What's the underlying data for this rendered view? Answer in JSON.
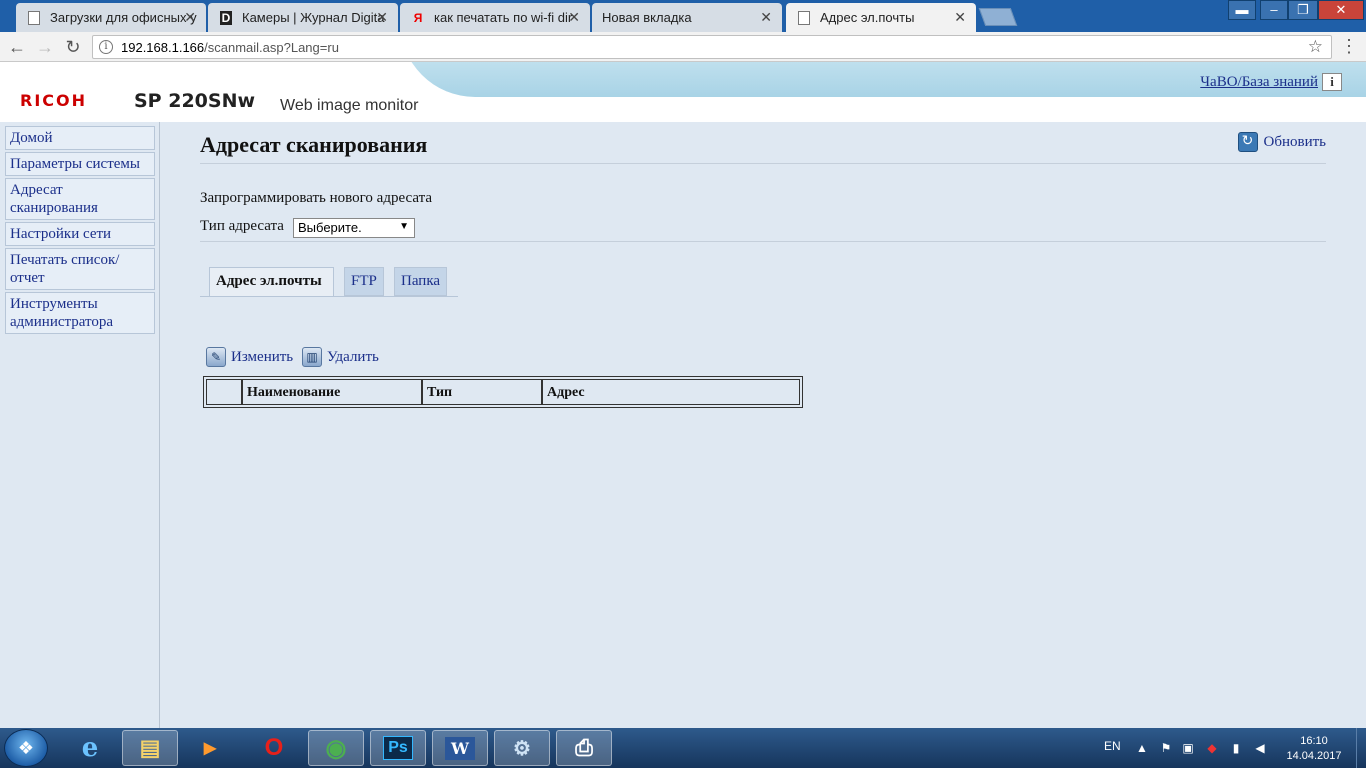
{
  "browser": {
    "tabs": [
      {
        "title": "Загрузки для офисных у",
        "icon": "page-icon"
      },
      {
        "title": "Камеры | Журнал Digita",
        "icon": "digital-d-icon"
      },
      {
        "title": "как печатать по wi-fi dir",
        "icon": "yandex-icon"
      },
      {
        "title": "Новая вкладка",
        "icon": "none"
      },
      {
        "title": "Адрес эл.почты",
        "icon": "page-icon"
      }
    ],
    "close_glyph": "✕",
    "url_host": "192.168.1.166",
    "url_path": "/scanmail.asp?Lang=ru"
  },
  "header": {
    "brand": "RICOH",
    "model": "SP 220SNw",
    "product": "Web image monitor",
    "faq_link": "ЧаВО/База знаний",
    "faq_icon": "i"
  },
  "sidebar": {
    "items": [
      {
        "label": "Домой"
      },
      {
        "label": "Параметры системы"
      },
      {
        "label": "Адресат сканирования"
      },
      {
        "label": "Настройки сети"
      },
      {
        "label": "Печатать список/ отчет"
      },
      {
        "label": "Инструменты администратора"
      }
    ]
  },
  "main": {
    "title": "Адресат сканирования",
    "refresh_label": "Обновить",
    "program_new": "Запрограммировать нового адресата",
    "type_label": "Тип адресата",
    "type_selected": "Выберите.",
    "tabs": [
      {
        "label": "Адрес эл.почты",
        "active": true
      },
      {
        "label": "FTP",
        "active": false
      },
      {
        "label": "Папка",
        "active": false
      }
    ],
    "actions": {
      "edit": "Изменить",
      "delete": "Удалить"
    },
    "table_headers": [
      "",
      "Наименование",
      "Тип",
      "Адрес"
    ]
  },
  "taskbar": {
    "apps": [
      {
        "name": "ie-icon",
        "glyph": "e"
      },
      {
        "name": "explorer-icon",
        "glyph": "▤"
      },
      {
        "name": "media-player-icon",
        "glyph": "▶"
      },
      {
        "name": "opera-icon",
        "glyph": "O"
      },
      {
        "name": "chrome-icon",
        "glyph": "◉"
      },
      {
        "name": "photoshop-icon",
        "glyph": "Ps"
      },
      {
        "name": "word-icon",
        "glyph": "W"
      },
      {
        "name": "control-panel-icon",
        "glyph": "⚙"
      },
      {
        "name": "network-printer-icon",
        "glyph": "⎙"
      }
    ],
    "lang": "EN",
    "time": "16:10",
    "date": "14.04.2017"
  },
  "colors": {
    "link": "#1b2f8a",
    "brand": "#cc0000",
    "taskbar": "#1f4a7c"
  }
}
